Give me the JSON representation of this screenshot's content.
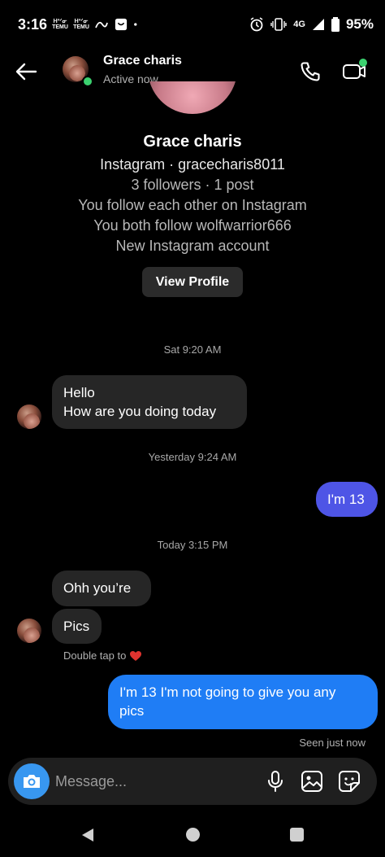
{
  "status_bar": {
    "time": "3:16",
    "app_label_top": "ᕼᐢᐟᓂ",
    "app_label_bottom": "TEMU",
    "battery_percent": "95%",
    "network": "4G",
    "icons": [
      "temu-icon",
      "temu-icon",
      "glyph-icon",
      "shopping-bag-icon",
      "dot-icon",
      "alarm-icon",
      "vibrate-icon",
      "signal-icon",
      "battery-icon"
    ]
  },
  "header": {
    "name": "Grace charis",
    "status": "Active now",
    "online_color": "#3bd16f"
  },
  "profile": {
    "name": "Grace charis",
    "handle_line": "Instagram · gracecharis8011",
    "stats_line": "3 followers · 1 post",
    "mutual_line": "You follow each other on Instagram",
    "mutual_follow_line": "You both follow wolfwarrior666",
    "new_account_line": "New Instagram account",
    "view_profile_label": "View Profile"
  },
  "messages": {
    "ts1": "Sat 9:20 AM",
    "m1_line1": "Hello",
    "m1_line2": "How are you doing today",
    "ts2": "Yesterday 9:24 AM",
    "m2": "I'm 13",
    "ts3": "Today 3:15 PM",
    "m3": "Ohh you’re",
    "m4": "Pics",
    "hint": "Double tap to",
    "m5_line1": "I'm 13 I'm not going to give you any",
    "m5_line2": "pics",
    "seen": "Seen just now"
  },
  "colors": {
    "bubble_in": "#262626",
    "bubble_out_purple": "#4e55e6",
    "bubble_out_blue": "#1f7df5",
    "heart": "#e0332f",
    "camera_button": "#3897f0"
  },
  "composer": {
    "placeholder": "Message..."
  }
}
